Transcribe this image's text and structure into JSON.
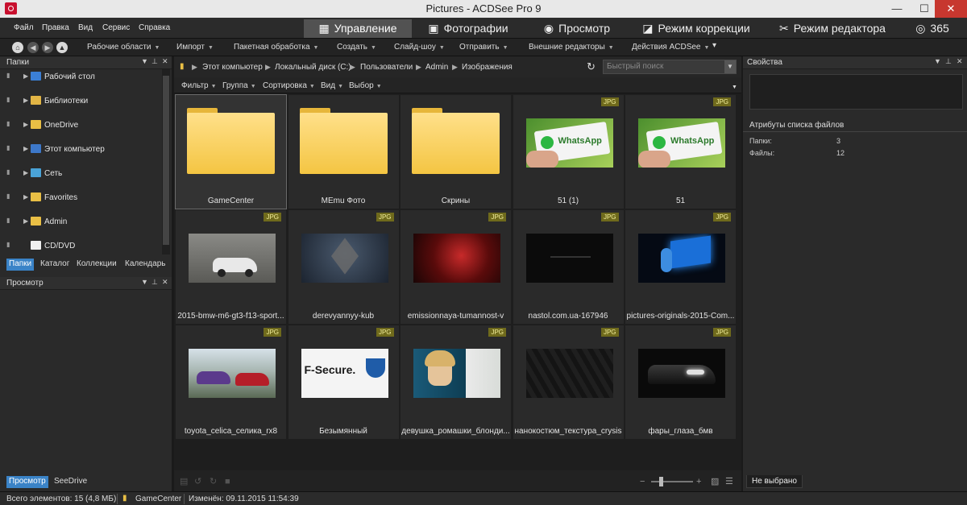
{
  "window": {
    "title": "Pictures - ACDSee Pro 9",
    "min": "—",
    "max": "☐",
    "close": "✕"
  },
  "menu": [
    "Файл",
    "Правка",
    "Вид",
    "Сервис",
    "Справка"
  ],
  "modes": [
    {
      "label": "Управление",
      "icon": "grid-icon",
      "glyph": "▦",
      "active": true
    },
    {
      "label": "Фотографии",
      "icon": "photos-icon",
      "glyph": "▣",
      "active": false
    },
    {
      "label": "Просмотр",
      "icon": "eye-icon",
      "glyph": "◉",
      "active": false
    },
    {
      "label": "Режим коррекции",
      "icon": "develop-icon",
      "glyph": "◪",
      "active": false
    },
    {
      "label": "Режим редактора",
      "icon": "edit-tools-icon",
      "glyph": "✂",
      "active": false
    },
    {
      "label": "365",
      "icon": "acdsee365-icon",
      "glyph": "◎",
      "active": false
    }
  ],
  "toolbar": [
    "Рабочие области",
    "Импорт",
    "Пакетная обработка",
    "Создать",
    "Слайд-шоу",
    "Отправить",
    "Внешние редакторы",
    "Действия ACDSee"
  ],
  "left_panel": {
    "title": "Папки",
    "folders": [
      {
        "label": "Рабочий стол",
        "icon": "desktop-icon",
        "color": "#3b7fd6"
      },
      {
        "label": "Библиотеки",
        "icon": "libraries-icon",
        "color": "#e2b545"
      },
      {
        "label": "OneDrive",
        "icon": "onedrive-folder-icon",
        "color": "#e9bf45"
      },
      {
        "label": "Этот компьютер",
        "icon": "computer-icon",
        "color": "#3d78c9"
      },
      {
        "label": "Сеть",
        "icon": "network-icon",
        "color": "#4aa3d8"
      },
      {
        "label": "Favorites",
        "icon": "favorites-folder-icon",
        "color": "#e9bf45"
      },
      {
        "label": "Admin",
        "icon": "user-folder-icon",
        "color": "#e9bf45"
      },
      {
        "label": "CD/DVD",
        "icon": "cd-dvd-icon",
        "color": "#f0f0f0"
      }
    ],
    "tabs": [
      "Папки",
      "Каталог",
      "Коллекции",
      "Календарь"
    ],
    "preview_title": "Просмотр",
    "bottom_tabs": [
      "Просмотр",
      "SeeDrive"
    ]
  },
  "path": [
    "Этот компьютер",
    "Локальный диск (C:)",
    "Пользователи",
    "Admin",
    "Изображения"
  ],
  "search": {
    "placeholder": "Быстрый поиск"
  },
  "filters": [
    "Фильтр",
    "Группа",
    "Сортировка",
    "Вид",
    "Выбор"
  ],
  "items": [
    {
      "name": "GameCenter",
      "type": "folder",
      "selected": true
    },
    {
      "name": "MEmu Фото",
      "type": "folder"
    },
    {
      "name": "Скрины",
      "type": "folder"
    },
    {
      "name": "51 (1)",
      "type": "jpg",
      "thumb": "whatsapp"
    },
    {
      "name": "51",
      "type": "jpg",
      "thumb": "whatsapp"
    },
    {
      "name": "2015-bmw-m6-gt3-f13-sport...",
      "type": "jpg",
      "thumb": "garage"
    },
    {
      "name": "derevyannyy-kub",
      "type": "jpg",
      "thumb": "cube"
    },
    {
      "name": "emissionnaya-tumannost-v",
      "type": "jpg",
      "thumb": "nebula"
    },
    {
      "name": "nastol.com.ua-167946",
      "type": "jpg",
      "thumb": "dark"
    },
    {
      "name": "pictures-originals-2015-Com...",
      "type": "jpg",
      "thumb": "blue"
    },
    {
      "name": "toyota_celica_селика_rx8",
      "type": "jpg",
      "thumb": "cars"
    },
    {
      "name": "Безымянный",
      "type": "jpg",
      "thumb": "fsecure"
    },
    {
      "name": "девушка_ромашки_блонди...",
      "type": "jpg",
      "thumb": "girl"
    },
    {
      "name": "нанокостюм_текстура_crysis",
      "type": "jpg",
      "thumb": "texture"
    },
    {
      "name": "фары_глаза_бмв",
      "type": "jpg",
      "thumb": "bmw"
    }
  ],
  "thumb_text": {
    "whatsapp": "WhatsApp",
    "fsecure": "F-Secure."
  },
  "jpg_badge": "JPG",
  "right_panel": {
    "title": "Свойства",
    "attrs_title": "Атрибуты списка файлов",
    "attrs": [
      {
        "label": "Папки:",
        "value": "3"
      },
      {
        "label": "Файлы:",
        "value": "12"
      }
    ],
    "tab": "Не выбрано"
  },
  "status": {
    "total": "Всего элементов: 15  (4,8 МБ)",
    "folder": "GameCenter",
    "modified": "Изменён: 09.11.2015 11:54:39"
  }
}
